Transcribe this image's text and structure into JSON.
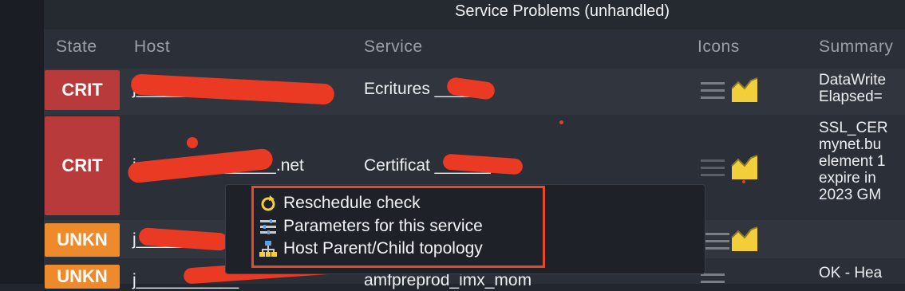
{
  "panel": {
    "title": "Service Problems (unhandled)"
  },
  "columns": {
    "state": "State",
    "host": "Host",
    "service": "Service",
    "icons": "Icons",
    "summary": "Summary"
  },
  "rows": [
    {
      "state": "CRIT",
      "host": "j_______________.net",
      "service": "Ecritures ______",
      "summary": "DataWrite\nElapsed="
    },
    {
      "state": "CRIT",
      "host": "j_______________.net",
      "service": "Certificat ______",
      "summary": "SSL_CER\nmynet.bu\nelement 1\nexpire in\n2023 GM"
    },
    {
      "state": "UNKN",
      "host": "j___________",
      "service": "",
      "summary": ""
    },
    {
      "state": "UNKN",
      "host": "j___________",
      "service": "amfpreprod_imx_mom",
      "summary": "OK - Hea"
    }
  ],
  "context_menu": {
    "items": [
      {
        "label": "Reschedule check",
        "icon": "reschedule-icon"
      },
      {
        "label": "Parameters for this service",
        "icon": "parameters-icon"
      },
      {
        "label": "Host Parent/Child topology",
        "icon": "topology-icon"
      }
    ]
  },
  "colors": {
    "crit": "#b83a3a",
    "unkn": "#ec8a2c",
    "highlight_box": "#e54b2b",
    "redaction": "#ea3a24",
    "graph_icon": "#f2cf3a"
  }
}
